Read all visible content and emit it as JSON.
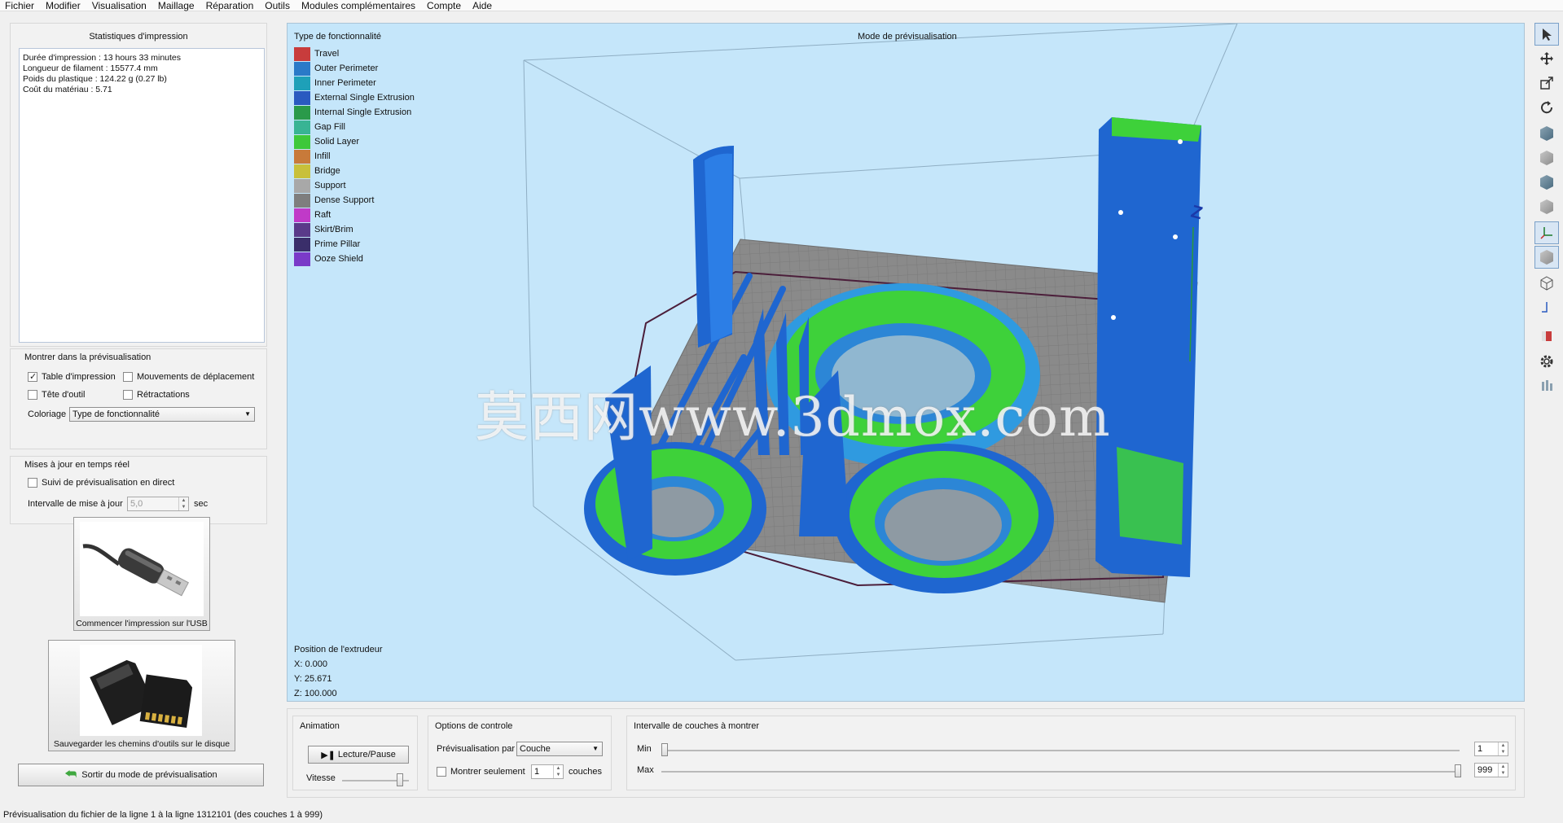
{
  "menu": [
    "Fichier",
    "Modifier",
    "Visualisation",
    "Maillage",
    "Réparation",
    "Outils",
    "Modules complémentaires",
    "Compte",
    "Aide"
  ],
  "stats": {
    "title": "Statistiques d'impression",
    "lines": [
      "Durée d'impression : 13 hours 33 minutes",
      "Longueur de filament : 15577.4 mm",
      "Poids du plastique : 124.22 g (0.27 lb)",
      "Coût du matériau : 5.71"
    ]
  },
  "show_in_preview": {
    "title": "Montrer dans la prévisualisation",
    "build_table": {
      "label": "Table d'impression",
      "checked": true
    },
    "travel_moves": {
      "label": "Mouvements de déplacement",
      "checked": false
    },
    "tool_head": {
      "label": "Tête d'outil",
      "checked": false
    },
    "retractions": {
      "label": "Rétractations",
      "checked": false
    },
    "coloring_label": "Coloriage",
    "coloring_value": "Type de fonctionnalité"
  },
  "realtime": {
    "title": "Mises à jour en temps réel",
    "live_preview": {
      "label": "Suivi de prévisualisation en direct",
      "checked": false
    },
    "interval_label": "Intervalle de mise à jour",
    "interval_value": "5,0",
    "interval_unit": "sec"
  },
  "usb_button_label": "Commencer l'impression sur l'USB",
  "sd_button_label": "Sauvegarder les chemins d'outils sur le disque",
  "exit_button_label": "Sortir du mode de prévisualisation",
  "viewport": {
    "title": "Mode de prévisualisation",
    "legend_title": "Type de fonctionnalité",
    "legend": [
      {
        "label": "Travel",
        "color": "#c83c3c"
      },
      {
        "label": "Outer Perimeter",
        "color": "#2a7ac8"
      },
      {
        "label": "Inner Perimeter",
        "color": "#1ea0b8"
      },
      {
        "label": "External Single Extrusion",
        "color": "#2a5ac0"
      },
      {
        "label": "Internal Single Extrusion",
        "color": "#2a9a4a"
      },
      {
        "label": "Gap Fill",
        "color": "#38b494"
      },
      {
        "label": "Solid Layer",
        "color": "#3ec83a"
      },
      {
        "label": "Infill",
        "color": "#c87a3a"
      },
      {
        "label": "Bridge",
        "color": "#c8c03a"
      },
      {
        "label": "Support",
        "color": "#a8a8a8"
      },
      {
        "label": "Dense Support",
        "color": "#7e7e7e"
      },
      {
        "label": "Raft",
        "color": "#c03ac8"
      },
      {
        "label": "Skirt/Brim",
        "color": "#5a3a8a"
      },
      {
        "label": "Prime Pillar",
        "color": "#3a2e6a"
      },
      {
        "label": "Ooze Shield",
        "color": "#7a3ac8"
      }
    ],
    "extruder_position_title": "Position de l'extrudeur",
    "x": "X: 0.000",
    "y": "Y: 25.671",
    "z": "Z: 100.000",
    "watermark": "莫西网www.3dmox.com"
  },
  "toolbar_icons": [
    "select-icon",
    "move-icon",
    "scale-icon",
    "rotate-icon",
    "view-iso-icon",
    "view-front-icon",
    "view-top-icon",
    "view-side-icon",
    "axes-icon",
    "solid-view-icon",
    "wireframe-icon",
    "center-icon",
    "build-icon",
    "settings-icon",
    "bars-icon"
  ],
  "animation": {
    "title": "Animation",
    "play_label": "Lecture/Pause",
    "speed_label": "Vitesse",
    "speed_level": 0.9
  },
  "control_options": {
    "title": "Options de controle",
    "preview_by_label": "Prévisualisation par",
    "preview_by_value": "Couche",
    "show_only_label": "Montrer seulement",
    "show_only_value": "1",
    "show_only_unit": "couches"
  },
  "layer_range": {
    "title": "Intervalle de couches à montrer",
    "min_label": "Min",
    "min_value": "1",
    "max_label": "Max",
    "max_value": "999"
  },
  "status_bar": "Prévisualisation du fichier de la ligne 1 à la ligne 1312101 (des couches 1 à 999)"
}
